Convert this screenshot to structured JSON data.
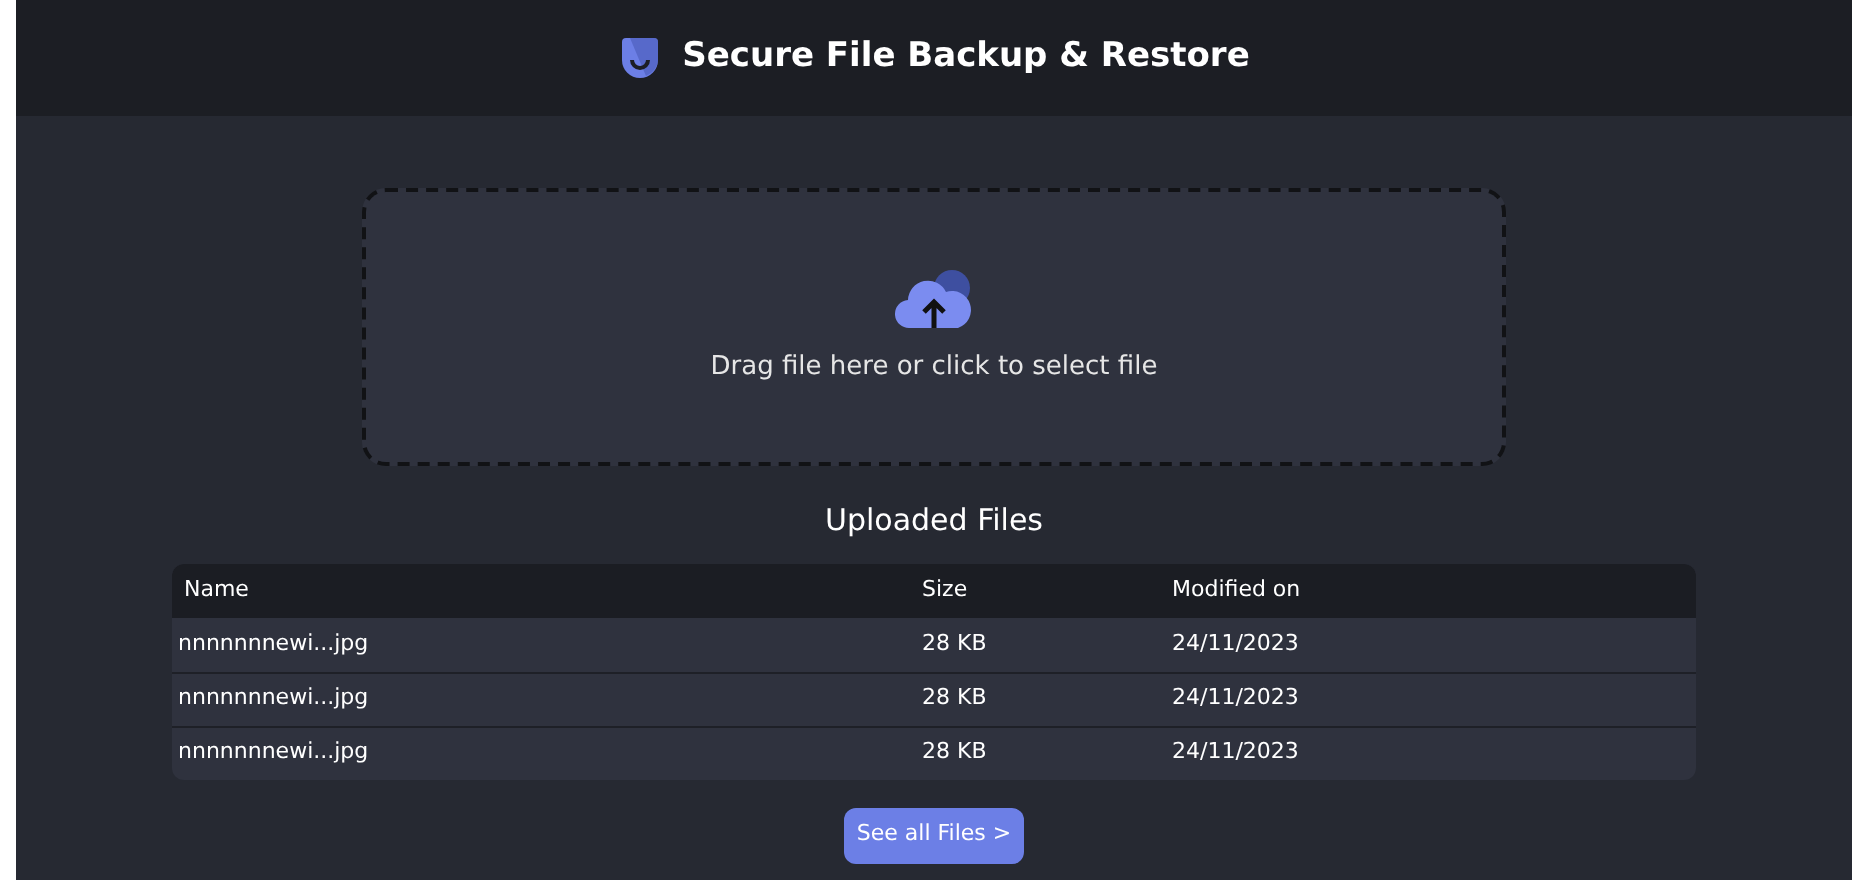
{
  "header": {
    "title": "Secure File Backup & Restore"
  },
  "dropzone": {
    "prompt": "Drag file here or click to select file"
  },
  "files": {
    "title": "Uploaded Files",
    "columns": [
      "Name",
      "Size",
      "Modified on"
    ],
    "rows": [
      [
        "nnnnnnnewi...jpg",
        "28 KB",
        "24/11/2023"
      ],
      [
        "nnnnnnnewi...jpg",
        "28 KB",
        "24/11/2023"
      ],
      [
        "nnnnnnnewi...jpg",
        "28 KB",
        "24/11/2023"
      ]
    ]
  },
  "see_all_button": "See all Files >"
}
